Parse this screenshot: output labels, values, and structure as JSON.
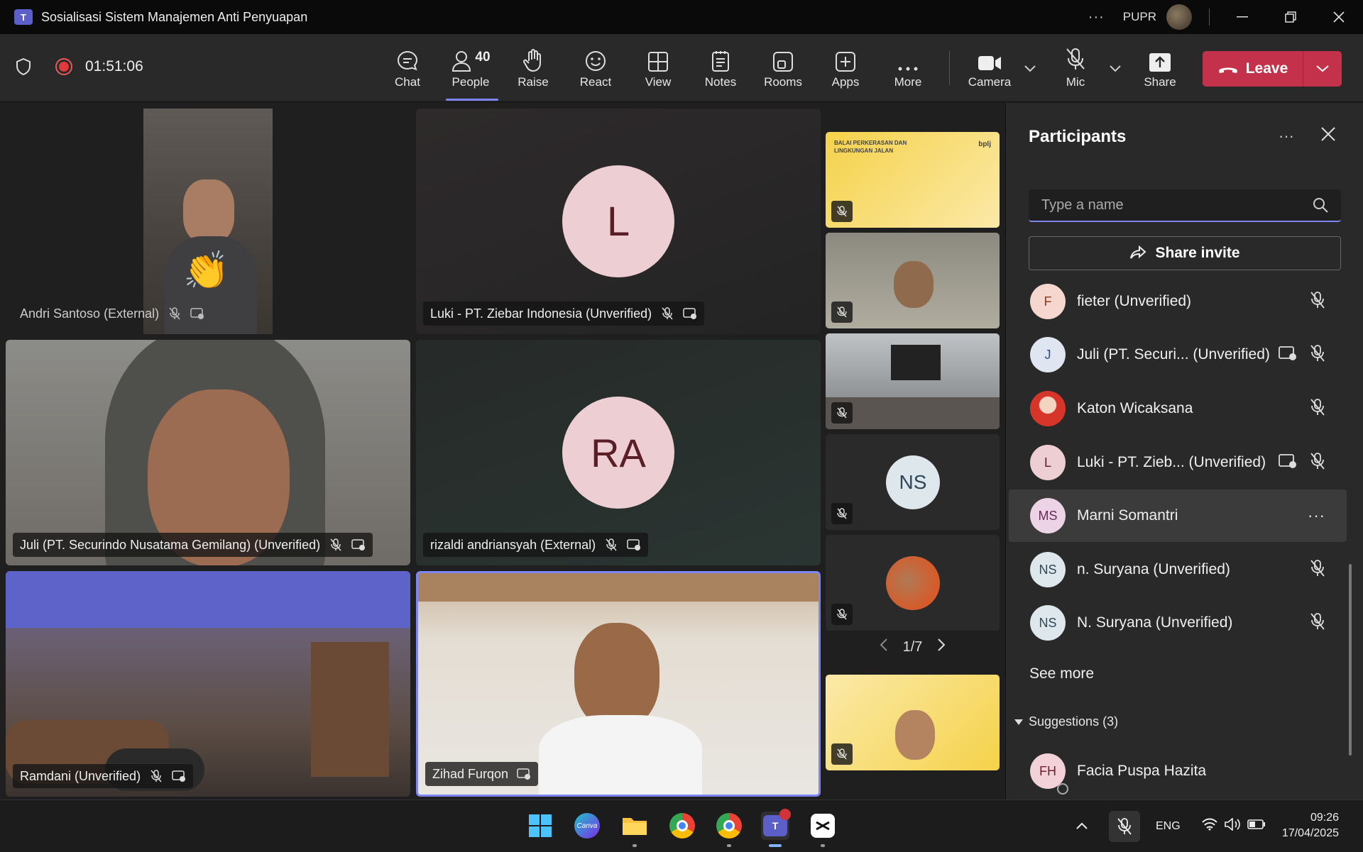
{
  "window": {
    "title": "Sosialisasi Sistem Manajemen Anti Penyuapan",
    "org": "PUPR"
  },
  "toolbar": {
    "timer": "01:51:06",
    "people_count": "40",
    "items": {
      "chat": "Chat",
      "people": "People",
      "raise": "Raise",
      "react": "React",
      "view": "View",
      "notes": "Notes",
      "rooms": "Rooms",
      "apps": "Apps",
      "more": "More",
      "camera": "Camera",
      "mic": "Mic",
      "share": "Share"
    },
    "leave": "Leave"
  },
  "tiles": {
    "andri": {
      "name": "Andri Santoso (External)"
    },
    "luki": {
      "name": "Luki - PT. Ziebar Indonesia (Unverified)",
      "initials": "L"
    },
    "juli": {
      "name": "Juli (PT. Securindo Nusatama Gemilang) (Unverified)"
    },
    "rizaldi": {
      "name": "rizaldi andriansyah (External)",
      "initials": "RA"
    },
    "ramdani": {
      "name": "Ramdani (Unverified)"
    },
    "zihad": {
      "name": "Zihad Furqon"
    }
  },
  "strip": {
    "slide_title_line1": "BALAI PERKERASAN DAN",
    "slide_title_line2": "LINGKUNGAN JALAN",
    "slide_logo": "bplj",
    "ns_initials": "NS",
    "page": "1/7"
  },
  "panel": {
    "title": "Participants",
    "search_placeholder": "Type a name",
    "share_invite": "Share invite",
    "participants": [
      {
        "initials": "F",
        "name": "fieter (Unverified)"
      },
      {
        "initials": "J",
        "name": "Juli (PT. Securi...  (Unverified)"
      },
      {
        "initials": "",
        "name": "Katon Wicaksana"
      },
      {
        "initials": "L",
        "name": "Luki - PT. Zieb...  (Unverified)"
      },
      {
        "initials": "MS",
        "name": "Marni Somantri"
      },
      {
        "initials": "NS",
        "name": "n. Suryana (Unverified)"
      },
      {
        "initials": "NS",
        "name": "N. Suryana (Unverified)"
      }
    ],
    "see_more": "See more",
    "suggestions": "Suggestions (3)",
    "suggested": {
      "initials": "FH",
      "name": "Facia Puspa Hazita"
    }
  },
  "taskbar": {
    "canva": "Canva",
    "lang": "ENG",
    "time": "09:26",
    "date": "17/04/2025"
  }
}
